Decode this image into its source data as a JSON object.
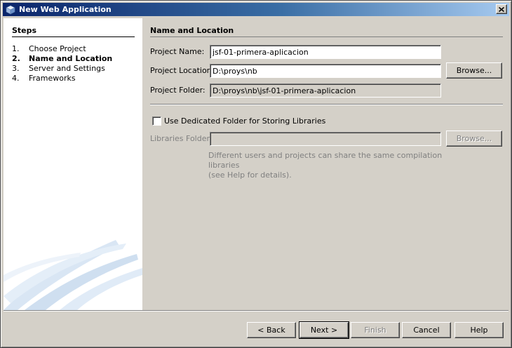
{
  "window": {
    "title": "New Web Application",
    "close_label": "×"
  },
  "steps": {
    "heading": "Steps",
    "items": [
      {
        "num": "1.",
        "label": "Choose Project"
      },
      {
        "num": "2.",
        "label": "Name and Location"
      },
      {
        "num": "3.",
        "label": "Server and Settings"
      },
      {
        "num": "4.",
        "label": "Frameworks"
      }
    ],
    "current_index": 1
  },
  "content": {
    "section_title": "Name and Location",
    "project_name": {
      "label": "Project Name:",
      "value": "jsf-01-primera-aplicacion"
    },
    "project_location": {
      "label": "Project Location:",
      "value": "D:\\proys\\nb",
      "browse_label": "Browse..."
    },
    "project_folder": {
      "label": "Project Folder:",
      "value": "D:\\proys\\nb\\jsf-01-primera-aplicacion"
    },
    "dedicated_folder": {
      "label": "Use Dedicated Folder for Storing Libraries",
      "checked": false
    },
    "libraries_folder": {
      "label": "Libraries Folder:",
      "value": "",
      "browse_label": "Browse..."
    },
    "help_text_line1": "Different users and projects can share the same compilation libraries",
    "help_text_line2": "(see Help for details)."
  },
  "buttons": {
    "back": "< Back",
    "next": "Next >",
    "finish": "Finish",
    "cancel": "Cancel",
    "help": "Help"
  },
  "colors": {
    "title_bar_start": "#0a246a",
    "title_bar_end": "#a6caf0",
    "dialog_face": "#d4d0c8",
    "decor_blue": "#c9dcf0"
  },
  "icons": {
    "title": "netbeans-cube-icon",
    "close": "close-icon"
  }
}
